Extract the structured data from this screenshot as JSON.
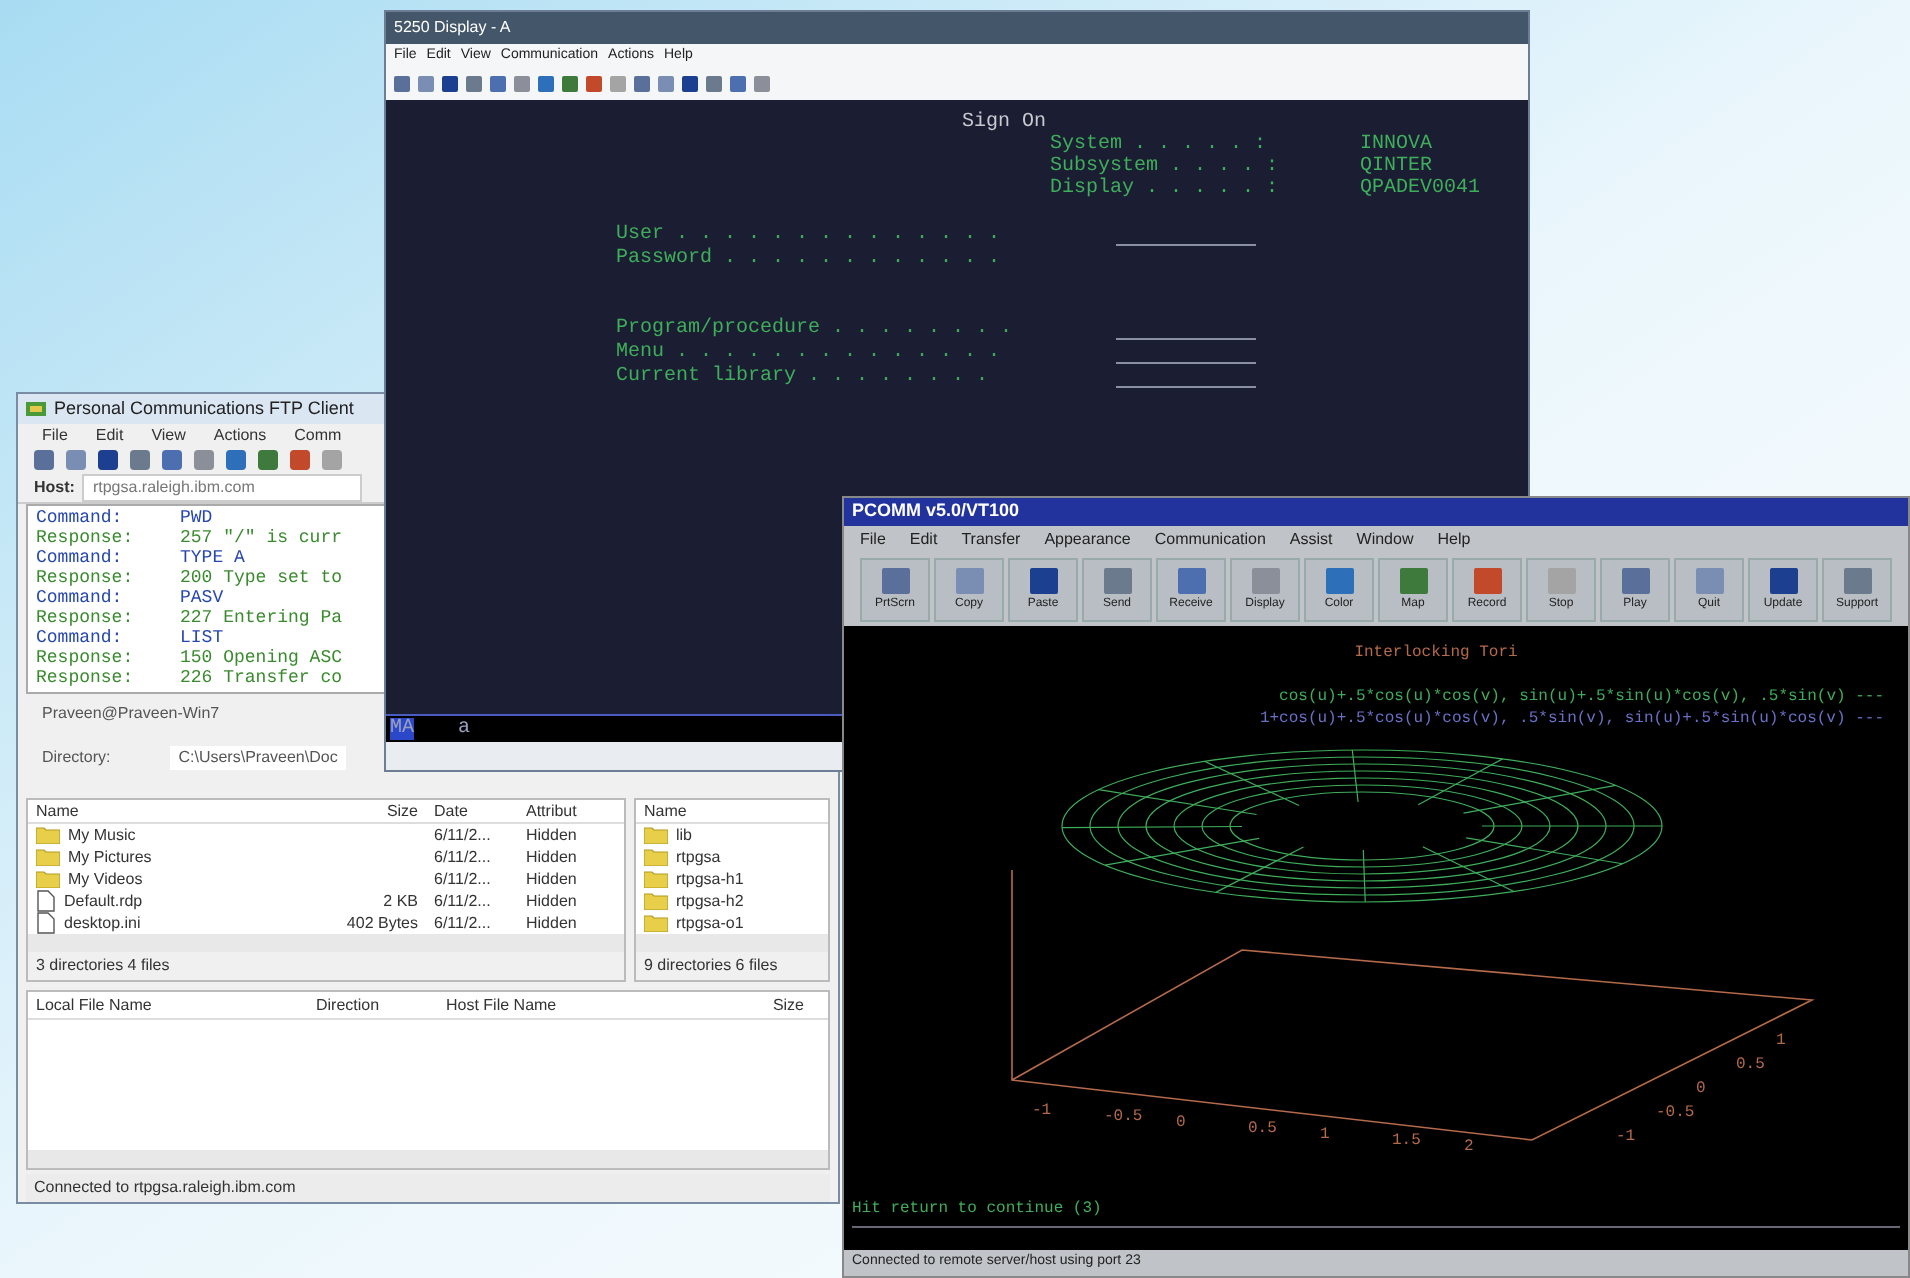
{
  "ftp_window": {
    "title": "Personal Communications FTP Client",
    "menu": [
      "File",
      "Edit",
      "View",
      "Actions",
      "Comm"
    ],
    "host_label": "Host:",
    "host_value": "rtpgsa.raleigh.ibm.com",
    "log": [
      {
        "kind": "command",
        "label": "Command:",
        "text": "PWD"
      },
      {
        "kind": "response",
        "label": "Response:",
        "text": "257 \"/\" is curr"
      },
      {
        "kind": "command",
        "label": "Command:",
        "text": "TYPE A"
      },
      {
        "kind": "response",
        "label": "Response:",
        "text": "200 Type set to"
      },
      {
        "kind": "command",
        "label": "Command:",
        "text": "PASV"
      },
      {
        "kind": "response",
        "label": "Response:",
        "text": "227 Entering Pa"
      },
      {
        "kind": "command",
        "label": "Command:",
        "text": "LIST"
      },
      {
        "kind": "response",
        "label": "Response:",
        "text": "150 Opening ASC"
      },
      {
        "kind": "response",
        "label": "Response:",
        "text": "226 Transfer co"
      }
    ],
    "local": {
      "user": "Praveen@Praveen-Win7",
      "directory_label": "Directory:",
      "directory_value": "C:\\Users\\Praveen\\Doc",
      "columns": [
        "Name",
        "Size",
        "Date",
        "Attribut"
      ],
      "rows": [
        {
          "kind": "folder",
          "name": "My Music",
          "date": "6/11/2...",
          "attr": "Hidden"
        },
        {
          "kind": "folder",
          "name": "My Pictures",
          "date": "6/11/2...",
          "attr": "Hidden"
        },
        {
          "kind": "folder",
          "name": "My Videos",
          "date": "6/11/2...",
          "attr": "Hidden"
        },
        {
          "kind": "file",
          "name": "Default.rdp",
          "size": "2 KB",
          "date": "6/11/2...",
          "attr": "Hidden"
        },
        {
          "kind": "file",
          "name": "desktop.ini",
          "size": "402 Bytes",
          "date": "6/11/2...",
          "attr": "Hidden"
        }
      ],
      "summary": "3 directories 4 files"
    },
    "remote": {
      "columns": [
        "Name"
      ],
      "rows": [
        {
          "kind": "folder",
          "name": "lib"
        },
        {
          "kind": "folder",
          "name": "rtpgsa"
        },
        {
          "kind": "folder",
          "name": "rtpgsa-h1"
        },
        {
          "kind": "folder",
          "name": "rtpgsa-h2"
        },
        {
          "kind": "folder",
          "name": "rtpgsa-o1"
        }
      ],
      "summary": "9 directories 6 files"
    },
    "transfers": {
      "columns": [
        "Local File Name",
        "Direction",
        "Host File Name",
        "Size"
      ]
    },
    "status": "Connected to rtpgsa.raleigh.ibm.com"
  },
  "display_window": {
    "title": "5250 Display - A",
    "menu": [
      "File",
      "Edit",
      "View",
      "Communication",
      "Actions",
      "Help"
    ],
    "screen": {
      "title": "Sign On",
      "info": [
        {
          "label": "System . . . . . :",
          "value": "INNOVA"
        },
        {
          "label": "Subsystem . . . . :",
          "value": "QINTER"
        },
        {
          "label": "Display . . . . . :",
          "value": "QPADEV0041"
        }
      ],
      "fields": [
        {
          "label": "User . . . . . . . . . . . . . .",
          "has_line": true
        },
        {
          "label": "Password . . . . . . . . . . . .",
          "has_line": false
        },
        {
          "label": "Program/procedure . . . . . . . .",
          "has_line": true
        },
        {
          "label": "Menu . . . . . . . . . . . . . .",
          "has_line": true
        },
        {
          "label": "Current library . . . . . . . .",
          "has_line": true
        }
      ]
    },
    "status_left": "MA",
    "status_text": "a"
  },
  "pcomm_window": {
    "title": "PCOMM v5.0/VT100",
    "menu": [
      "File",
      "Edit",
      "Transfer",
      "Appearance",
      "Communication",
      "Assist",
      "Window",
      "Help"
    ],
    "toolbar": [
      "PrtScrn",
      "Copy",
      "Paste",
      "Send",
      "Receive",
      "Display",
      "Color",
      "Map",
      "Record",
      "Stop",
      "Play",
      "Quit",
      "Update",
      "Support"
    ],
    "plot": {
      "title": "Interlocking Tori",
      "key": [
        "cos(u)+.5*cos(u)*cos(v), sin(u)+.5*sin(u)*cos(v), .5*sin(v) ---",
        "1+cos(u)+.5*cos(u)*cos(v), .5*sin(v), sin(u)+.5*sin(u)*cos(v) ---"
      ],
      "xticks": [
        "-1",
        "-0.5",
        "0",
        "0.5",
        "1",
        "1.5",
        "2"
      ],
      "yticks": [
        "-1",
        "-0.5",
        "0",
        "0.5",
        "1"
      ]
    },
    "prompt": "Hit return to continue (3)",
    "status": "Connected to remote server/host using port 23"
  }
}
